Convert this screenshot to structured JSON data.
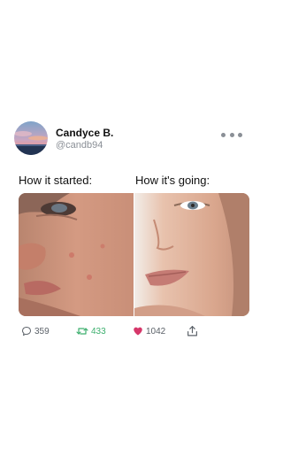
{
  "post": {
    "author_name": "Candyce B.",
    "author_handle": "@candb94",
    "caption_left": "How it started:",
    "caption_right": "How it's going:",
    "stats": {
      "replies": "359",
      "retweets": "433",
      "likes": "1042"
    }
  },
  "icons": {
    "more": "more-horizontal-icon",
    "reply": "speech-bubble-icon",
    "retweet": "retweet-icon",
    "like": "heart-icon",
    "share": "share-icon"
  },
  "colors": {
    "retweet": "#3daf6e",
    "like": "#d6376a",
    "muted": "#8a8f96"
  }
}
